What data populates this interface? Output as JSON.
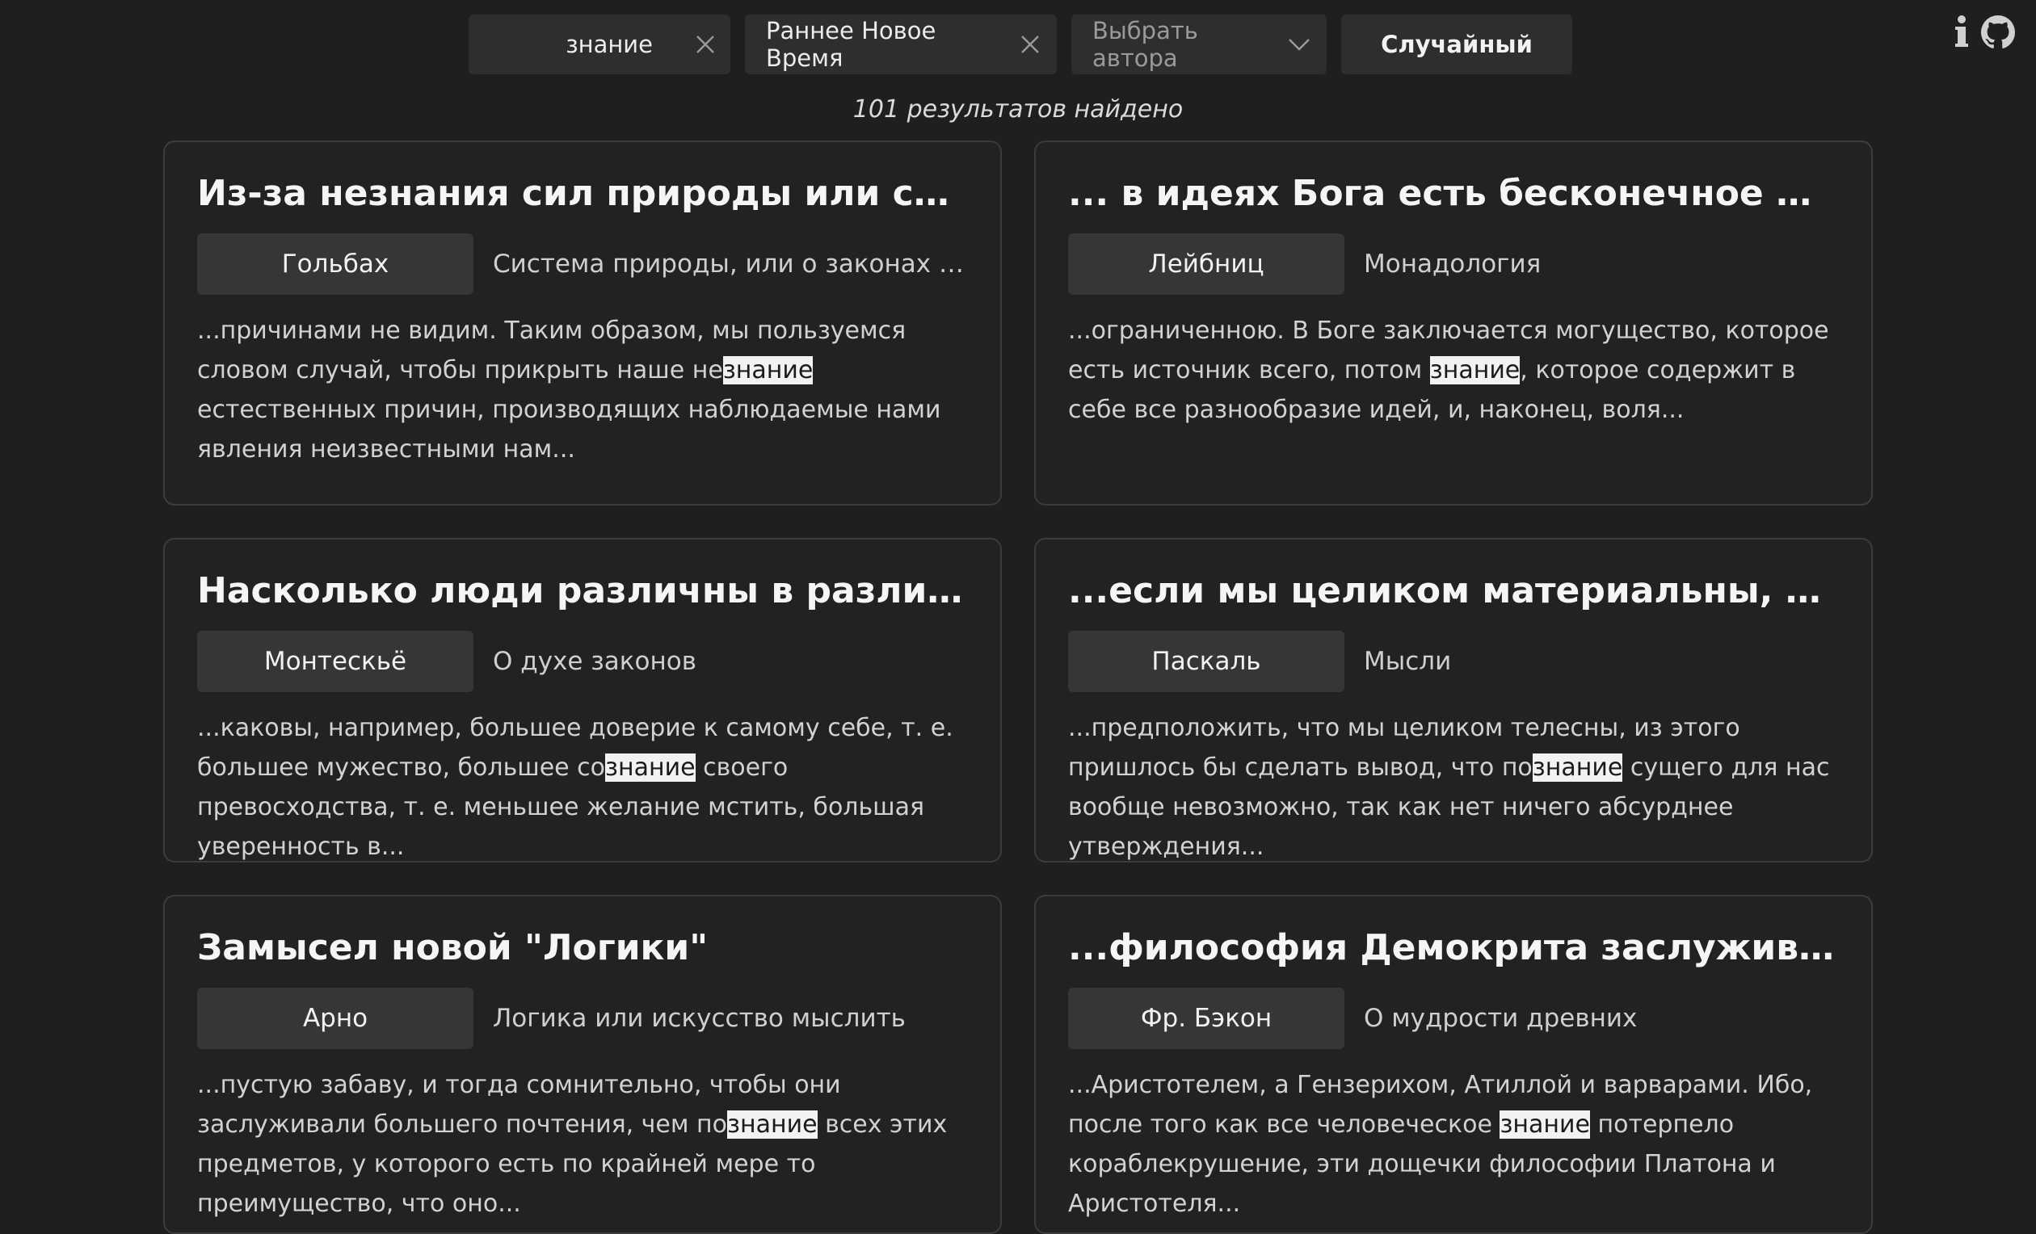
{
  "toolbar": {
    "search_value": "знание",
    "era_value": "Раннее Новое Время",
    "author_placeholder": "Выбрать автора",
    "random_label": "Случайный"
  },
  "results_count": "101 результатов найдено",
  "icons": {
    "info": "info-icon",
    "github": "github-icon",
    "clear": "close-icon",
    "dropdown": "chevron-down-icon"
  },
  "colors": {
    "background": "#1f1f1f",
    "card_bg": "#222222",
    "chip_bg": "#363636",
    "highlight_bg": "#f2f2f2"
  },
  "cards": [
    {
      "title": "Из-за незнания сил природы или свойств ...",
      "author": "Гольбах",
      "work": "Система природы, или о законах м...",
      "excerpt_before": "...причинами не видим. Таким образом, мы пользуемся словом случай, чтобы прикрыть наше не",
      "excerpt_match": "знание",
      "excerpt_after": " естественных причин, производящих наблюдаемые нами явления неизвестными нам..."
    },
    {
      "title": "... в идеях Бога есть бесконечное множес...",
      "author": "Лейбниц",
      "work": "Монадология",
      "excerpt_before": "...ограниченною. В Боге заключается могущество, которое есть источник всего, потом ",
      "excerpt_match": "знание",
      "excerpt_after": ", которое содержит в себе все разнообразие идей, и, наконец, воля..."
    },
    {
      "title": "Насколько люди различны в различных к...",
      "author": "Монтескьё",
      "work": "О духе законов",
      "excerpt_before": "...каковы, например, большее доверие к самому себе, т. е. большее мужество, большее со",
      "excerpt_match": "знание",
      "excerpt_after": " своего превосходства, т. е. меньшее желание мстить, большая уверенность в..."
    },
    {
      "title": "...если мы целиком материальны, познан...",
      "author": "Паскаль",
      "work": "Мысли",
      "excerpt_before": "...предположить, что мы целиком телесны, из этого пришлось бы сделать вывод, что по",
      "excerpt_match": "знание",
      "excerpt_after": " сущего для нас вообще невозможно, так как нет ничего абсурднее утверждения..."
    },
    {
      "title": "Замысел новой \"Логики\"",
      "author": "Арно",
      "work": "Логика или искусство мыслить",
      "excerpt_before": "...пустую забаву, и тогда сомнительно, чтобы они заслуживали большего почтения, чем по",
      "excerpt_match": "знание",
      "excerpt_after": " всех этих предметов, у которого есть по крайней мере то преимущество, что оно..."
    },
    {
      "title": "...философия Демокрита заслуживает тог...",
      "author": "Фр. Бэкон",
      "work": "О мудрости древних",
      "excerpt_before": "...Аристотелем, а Гензерихом, Атиллой и варварами. Ибо, после того как все человеческое ",
      "excerpt_match": "знание",
      "excerpt_after": " потерпело кораблекрушение, эти дощечки философии Платона и Аристотеля..."
    }
  ]
}
